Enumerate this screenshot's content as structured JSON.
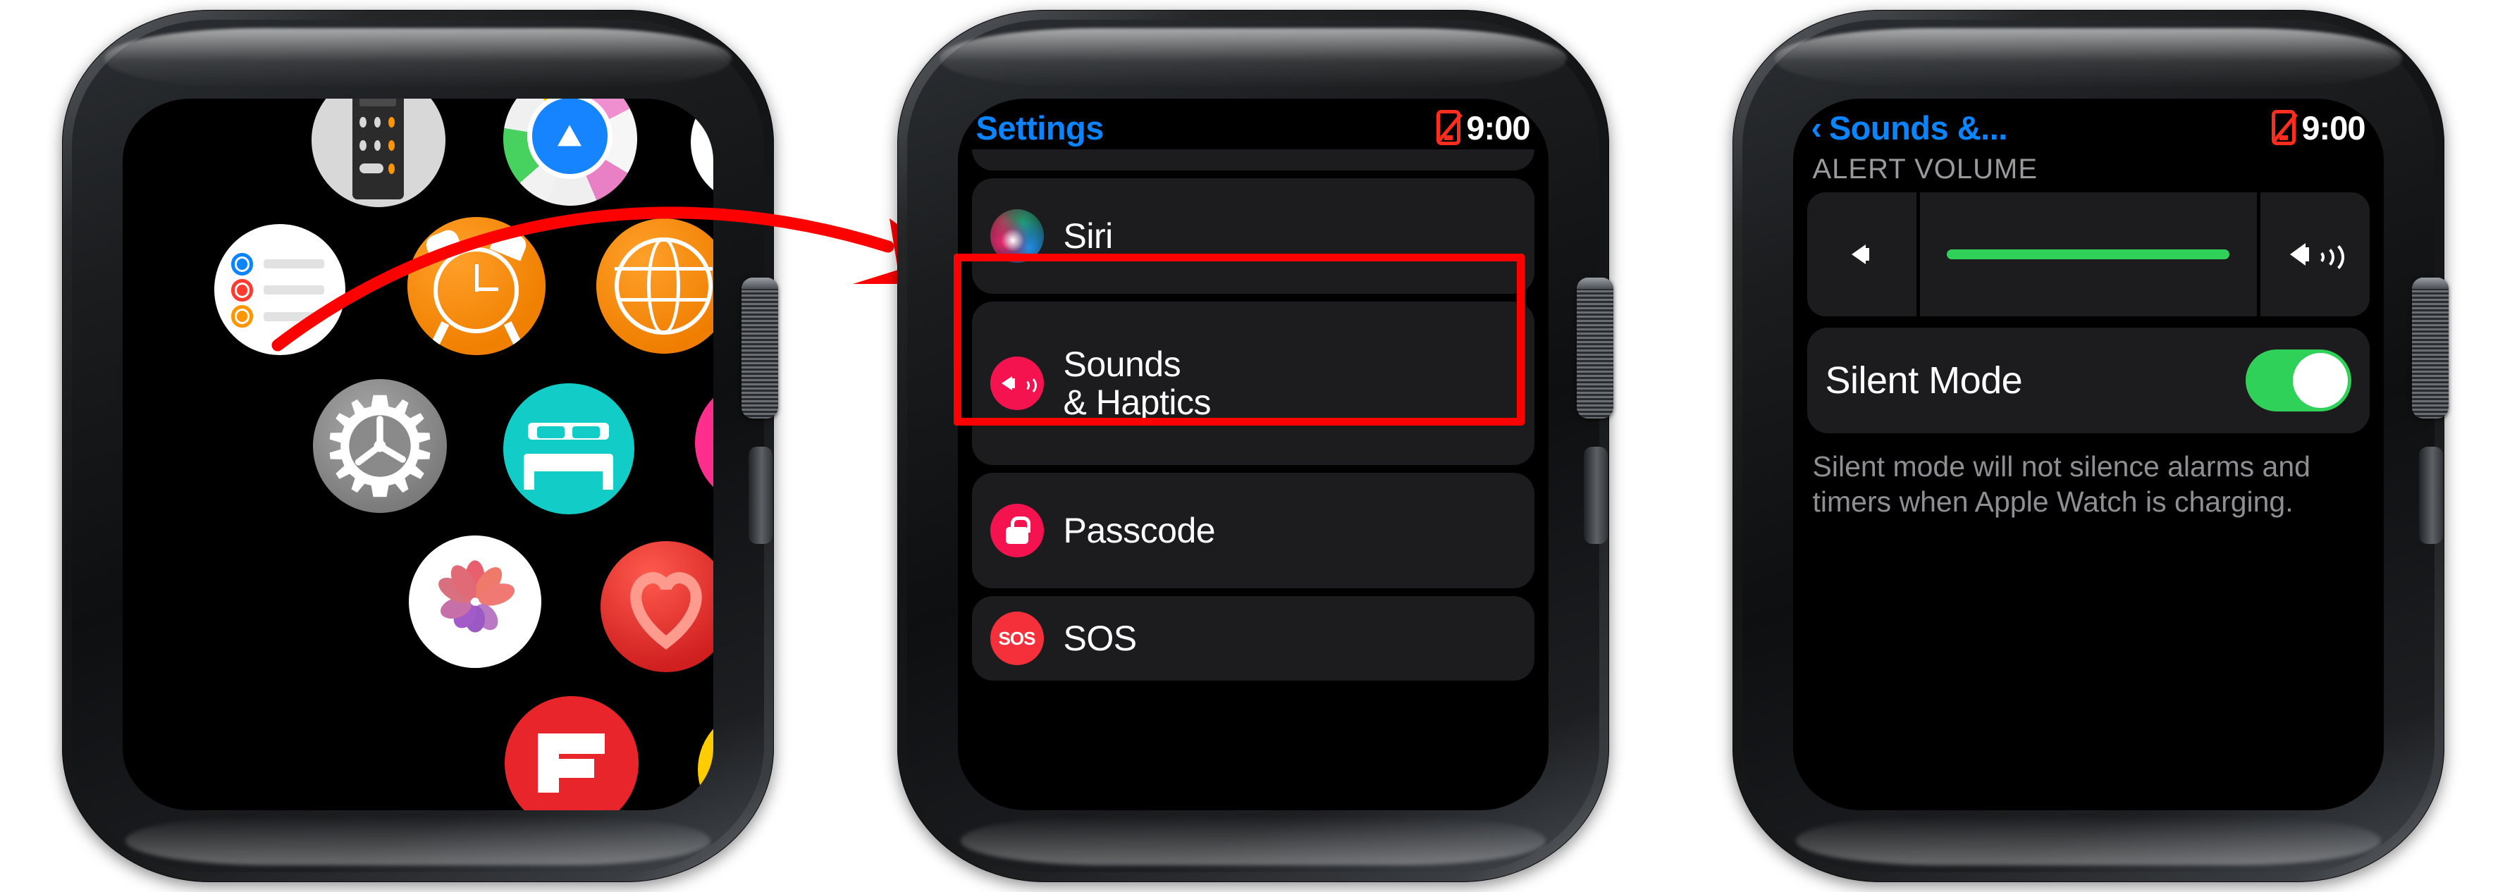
{
  "panels": [
    {
      "id": "app-grid",
      "name": "Apple Watch home screen app grid",
      "apps": [
        {
          "name": "Calculator",
          "icon": "calculator-icon"
        },
        {
          "name": "Maps",
          "icon": "maps-icon"
        },
        {
          "name": "Reminders",
          "icon": "reminders-icon"
        },
        {
          "name": "Alarms",
          "icon": "alarm-clock-icon"
        },
        {
          "name": "World Clock",
          "icon": "globe-icon"
        },
        {
          "name": "Settings",
          "icon": "settings-gear-icon"
        },
        {
          "name": "Sleep",
          "icon": "bed-icon"
        },
        {
          "name": "Breathe",
          "icon": "breathe-icon"
        },
        {
          "name": "Heart Rate",
          "icon": "heart-icon"
        },
        {
          "name": "Flipboard",
          "icon": "flipboard-icon"
        }
      ]
    },
    {
      "id": "settings-list",
      "status": {
        "title": "Settings",
        "time": "9:00",
        "phone_icon": "disconnected-phone-icon"
      },
      "rows": [
        {
          "label": "Siri",
          "icon": "siri-orb-icon"
        },
        {
          "label_line1": "Sounds",
          "label_line2": "& Haptics",
          "icon": "sound-speaker-icon",
          "highlighted": true
        },
        {
          "label": "Passcode",
          "icon": "lock-icon"
        },
        {
          "label": "SOS",
          "icon": "sos-icon"
        }
      ]
    },
    {
      "id": "sounds-haptics",
      "status": {
        "back": "‹",
        "title": "Sounds &...",
        "time": "9:00",
        "phone_icon": "disconnected-phone-icon"
      },
      "section_label": "ALERT VOLUME",
      "volume": {
        "min_icon": "volume-min-icon",
        "max_icon": "volume-max-icon",
        "level_percent": 84
      },
      "toggle": {
        "label": "Silent Mode",
        "state": "on"
      },
      "footnote": "Silent mode will not silence alarms and timers when Apple Watch is charging."
    }
  ],
  "colors": {
    "accent_blue": "#0a84ff",
    "highlight_red": "#ff0000",
    "toggle_green": "#30d158",
    "icon_pink": "#f5134f",
    "screen_bg": "#000000",
    "row_bg": "#1c1c1e"
  }
}
